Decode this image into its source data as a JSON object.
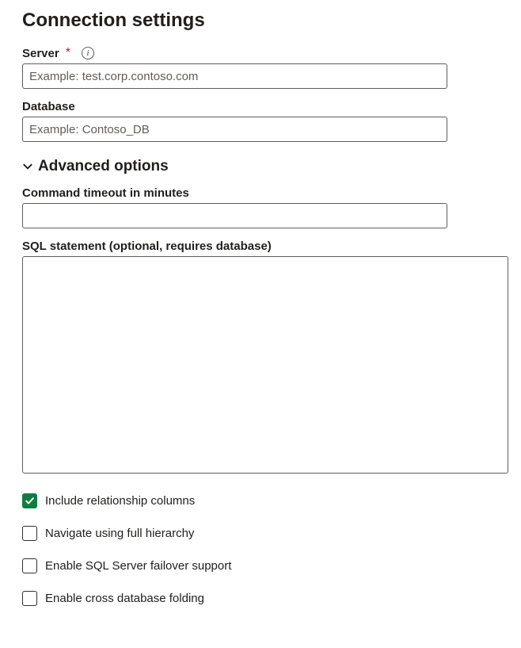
{
  "title": "Connection settings",
  "server": {
    "label": "Server",
    "required": true,
    "placeholder": "Example: test.corp.contoso.com",
    "value": ""
  },
  "database": {
    "label": "Database",
    "placeholder": "Example: Contoso_DB",
    "value": ""
  },
  "advanced": {
    "label": "Advanced options",
    "expanded": true
  },
  "timeout": {
    "label": "Command timeout in minutes",
    "value": ""
  },
  "sql": {
    "label": "SQL statement (optional, requires database)",
    "value": ""
  },
  "options": [
    {
      "label": "Include relationship columns",
      "checked": true
    },
    {
      "label": "Navigate using full hierarchy",
      "checked": false
    },
    {
      "label": "Enable SQL Server failover support",
      "checked": false
    },
    {
      "label": "Enable cross database folding",
      "checked": false
    }
  ]
}
